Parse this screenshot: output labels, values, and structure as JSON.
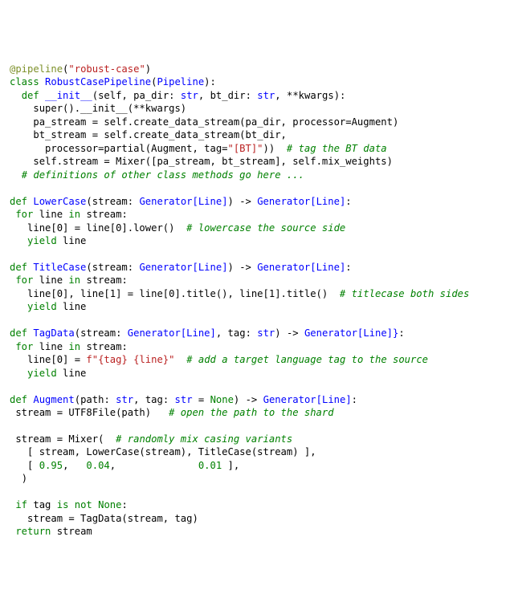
{
  "decorator": {
    "name": "@pipeline",
    "arg": "\"robust-case\""
  },
  "class": {
    "name": "RobustCasePipeline",
    "base": "Pipeline",
    "init": {
      "name": "__init__",
      "params": {
        "self": "self",
        "pa_dir": "pa_dir",
        "pa_dir_type": "str",
        "bt_dir": "bt_dir",
        "bt_dir_type": "str",
        "kwargs": "**kwargs"
      },
      "body": {
        "super_call": "super().__init__(**kwargs)",
        "pa_assign_lhs": "pa_stream",
        "pa_assign_rhs": "self.create_data_stream(pa_dir, processor=Augment)",
        "bt_assign_lhs": "bt_stream",
        "bt_assign_rhs_l1": "self.create_data_stream(bt_dir,",
        "bt_assign_rhs_l2a": "processor=partial(Augment, tag=",
        "bt_tag_str": "\"[BT]\"",
        "bt_assign_rhs_l2b": "))",
        "bt_comment": "# tag the BT data",
        "mix_lhs": "self.stream",
        "mix_rhs": "Mixer([pa_stream, bt_stream], self.mix_weights)"
      }
    },
    "trailing_comment": "# definitions of other class methods go here ..."
  },
  "fn_lowercase": {
    "name": "LowerCase",
    "param": "stream",
    "param_type": "Generator[Line]",
    "ret_type": "Generator[Line]",
    "loop_var": "line",
    "assign": "line[0] = line[0].lower()",
    "comment": "# lowercase the source side",
    "yield": "line"
  },
  "fn_titlecase": {
    "name": "TitleCase",
    "param": "stream",
    "param_type": "Generator[Line]",
    "ret_type": "Generator[Line]",
    "loop_var": "line",
    "assign": "line[0], line[1] = line[0].title(), line[1].title()",
    "comment": "# titlecase both sides",
    "yield": "line"
  },
  "fn_tagdata": {
    "name": "TagData",
    "param1": "stream",
    "param1_type": "Generator[Line]",
    "param2": "tag",
    "param2_type": "str",
    "ret_type": "Generator[Line]}",
    "loop_var": "line",
    "assign_lhs": "line[0]",
    "fstring_open": "f\"",
    "fstring_body": "{tag} {line}",
    "fstring_close": "\"",
    "comment": "# add a target language tag to the source",
    "yield": "line"
  },
  "fn_augment": {
    "name": "Augment",
    "param1": "path",
    "param1_type": "str",
    "param2": "tag",
    "param2_type": "str",
    "param2_default": "None",
    "ret_type": "Generator[Line]",
    "open_assign": "stream = UTF8File(path)",
    "open_comment": "# open the path to the shard",
    "mixer_head": "stream = Mixer(",
    "mixer_comment": "# randomly mix casing variants",
    "mixer_line1": "[ stream, LowerCase(stream), TitleCase(stream) ],",
    "mixer_line2_open": "[ ",
    "w1": "0.95",
    "w2": "0.04",
    "w3": "0.01",
    "mixer_line2_close": " ],",
    "close_paren": ")",
    "if_cond_a": "tag",
    "if_cond_b": "None",
    "if_body": "stream = TagData(stream, tag)",
    "ret": "stream"
  },
  "kw": {
    "class": "class",
    "def": "def",
    "for": "for",
    "in": "in",
    "yield": "yield",
    "if": "if",
    "is_not": "is not",
    "return": "return"
  }
}
